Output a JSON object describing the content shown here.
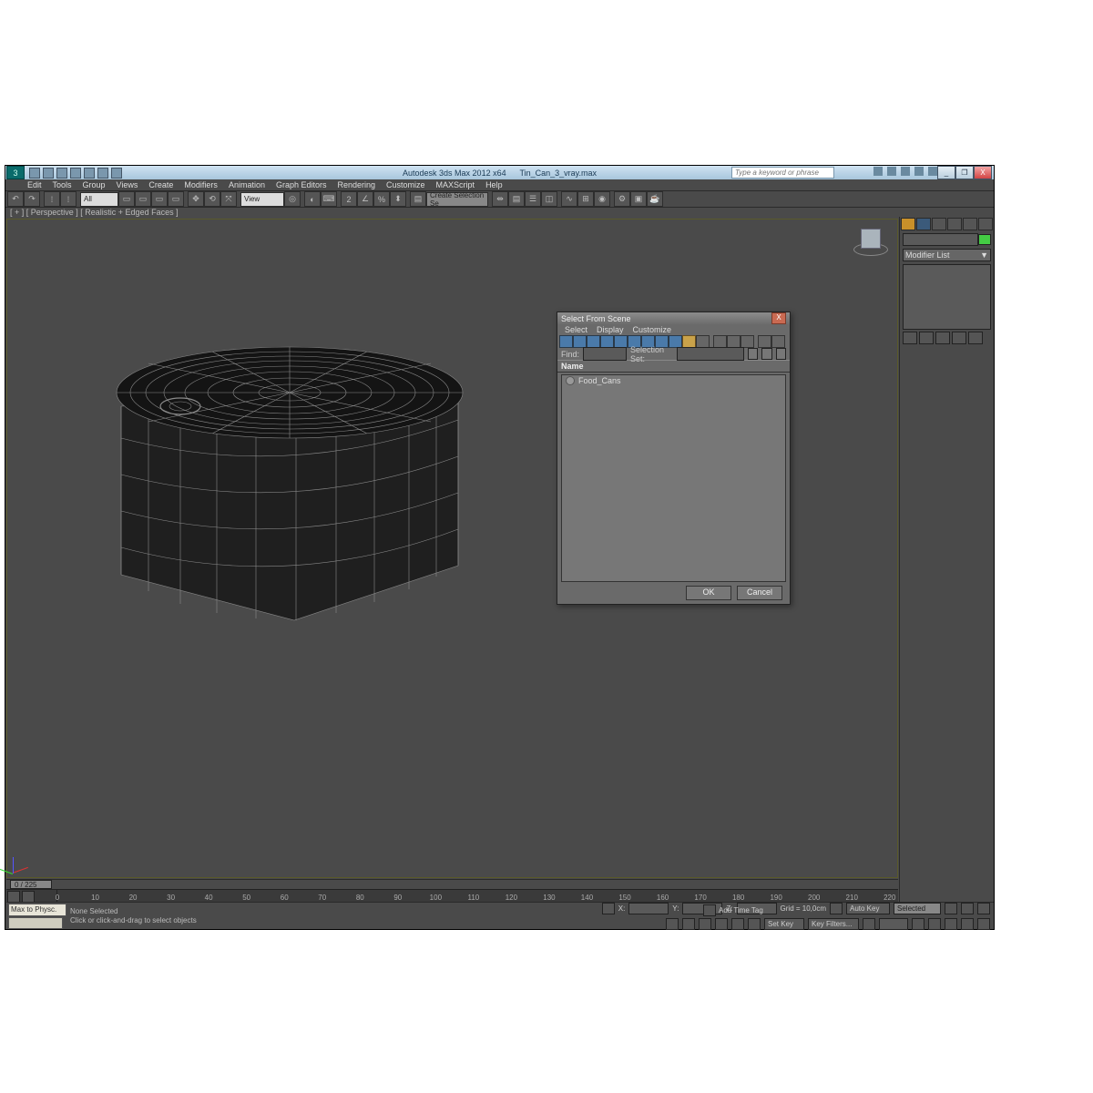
{
  "title": {
    "app": "Autodesk 3ds Max 2012 x64",
    "file": "Tin_Can_3_vray.max",
    "search_placeholder": "Type a keyword or phrase"
  },
  "window_controls": {
    "min": "_",
    "max": "❐",
    "close": "X"
  },
  "menu": [
    "Edit",
    "Tools",
    "Group",
    "Views",
    "Create",
    "Modifiers",
    "Animation",
    "Graph Editors",
    "Rendering",
    "Customize",
    "MAXScript",
    "Help"
  ],
  "toolbar": {
    "selset_dropdown": "All",
    "view_dropdown": "View",
    "create_sel": "Create Selection Se"
  },
  "viewport_label": "[ + ] [ Perspective ] [ Realistic + Edged Faces ]",
  "command_panel": {
    "modifier_list_label": "Modifier List"
  },
  "dialog": {
    "title": "Select From Scene",
    "menu": [
      "Select",
      "Display",
      "Customize"
    ],
    "find_label": "Find:",
    "find_value": "",
    "selset_label": "Selection Set:",
    "selset_value": "",
    "header": "Name",
    "rows": [
      "Food_Cans"
    ],
    "ok": "OK",
    "cancel": "Cancel"
  },
  "trackbar": {
    "frame_label": "0 / 225"
  },
  "timeline_ticks": [
    "0",
    "10",
    "20",
    "30",
    "40",
    "50",
    "60",
    "70",
    "80",
    "90",
    "100",
    "110",
    "120",
    "130",
    "140",
    "150",
    "160",
    "170",
    "180",
    "190",
    "200",
    "210",
    "220"
  ],
  "status": {
    "max_button": "Max to Physc.",
    "line1": "None Selected",
    "line2": "Click or click-and-drag to select objects",
    "add_time_tag": "Add Time Tag",
    "x": "X:",
    "y": "Y:",
    "z": "Z:",
    "grid": "Grid = 10,0cm",
    "autokey": "Auto Key",
    "setkey": "Set Key",
    "selected": "Selected",
    "keyfilters": "Key Filters..."
  }
}
